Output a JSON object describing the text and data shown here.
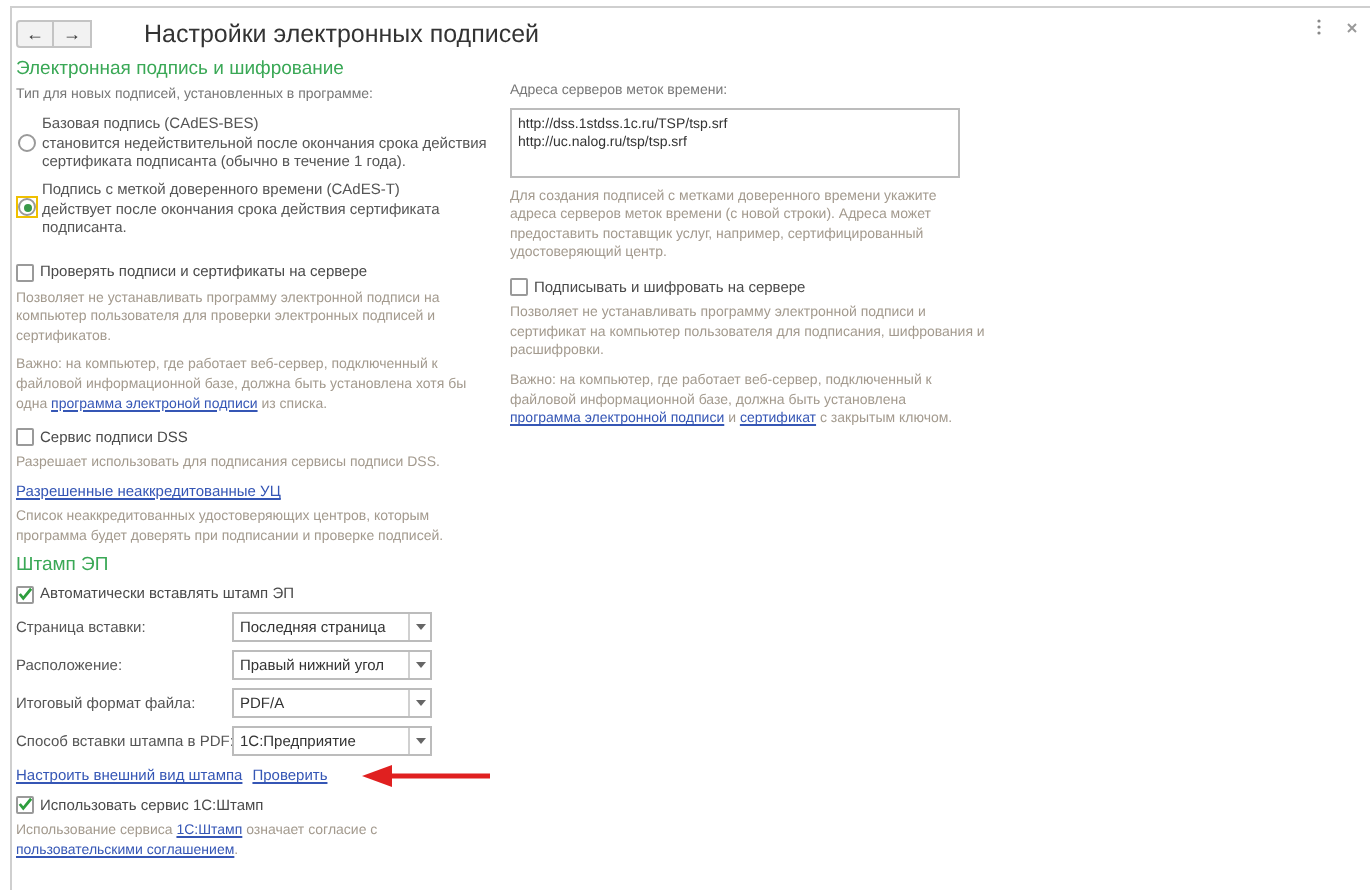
{
  "window": {
    "title": "Настройки электронных подписей",
    "nav": [
      "←",
      "→"
    ]
  },
  "left": {
    "section_title": "Электронная подпись и шифрование",
    "type_label": "Тип для новых подписей, установленных в программе:",
    "signature_types": [
      {
        "title": "Базовая подпись (CAdES-BES)",
        "description": "становится недействительной после окончания срока действия сертификата подписанта (обычно в течение 1 года).",
        "selected": false
      },
      {
        "title": "Подпись с меткой доверенного времени (CAdES-T)",
        "description": "действует после окончания срока действия сертификата подписанта.",
        "selected": true
      }
    ],
    "check_on_server": {
      "label": "Проверять подписи и сертификаты на сервере",
      "checked": false,
      "description": "Позволяет не устанавливать программу электронной подписи на компьютер пользователя для проверки электронных подписей и сертификатов.",
      "note": [
        {
          "text": "Важно: на компьютер, где работает веб-сервер, подключенный к файловой информационной базе, должна быть установлена хотя бы одна "
        },
        {
          "text": "программа электроной подписи",
          "link": true
        },
        {
          "text": " из списка."
        }
      ]
    },
    "dss": {
      "label": "Сервис подписи DSS",
      "checked": false,
      "description": "Разрешает использовать для подписания сервисы подписи DSS."
    },
    "untrusted_ca": {
      "link": "Разрешенные неаккредитованные УЦ",
      "description": "Список неаккредитованных удостоверяющих центров, которым программа будет доверять при подписании и проверке подписей."
    },
    "stamp": {
      "title": "Штамп ЭП",
      "auto_insert": {
        "label": "Автоматически вставлять штамп ЭП",
        "checked": true
      },
      "fields": [
        {
          "label": "Страница вставки:",
          "value": "Последняя страница"
        },
        {
          "label": "Расположение:",
          "value": "Правый нижний угол"
        },
        {
          "label": "Итоговый формат файла:",
          "value": "PDF/A"
        },
        {
          "label": "Способ вставки штампа в PDF:",
          "value": "1С:Предприятие"
        }
      ],
      "links": [
        "Настроить внешний вид штампа",
        "Проверить"
      ],
      "use_service": {
        "label": "Использовать сервис 1С:Штамп",
        "checked": true
      },
      "service_note": [
        {
          "text": "Использование сервиса "
        },
        {
          "text": "1С:Штамп",
          "link": true
        },
        {
          "text": " означает согласие с "
        },
        {
          "text": "пользовательскими соглашением",
          "link": true
        },
        {
          "text": "."
        }
      ]
    }
  },
  "right": {
    "timestamp_servers": {
      "label": "Адреса серверов меток времени:",
      "lines": [
        "http://dss.1stdss.1c.ru/TSP/tsp.srf",
        "http://uc.nalog.ru/tsp/tsp.srf"
      ],
      "description": "Для создания подписей с метками доверенного времени укажите адреса серверов меток времени (с новой строки). Адреса может предоставить поставщик услуг, например, сертифицированный удостоверяющий центр."
    },
    "sign_on_server": {
      "label": "Подписывать и шифровать на сервере",
      "checked": false,
      "description": "Позволяет не устанавливать программу электронной подписи и сертификат на компьютер пользователя для подписания, шифрования и расшифровки.",
      "note": [
        {
          "text": "Важно: на компьютер, где работает веб-сервер, подключенный к файловой информационной базе, должна быть установлена "
        },
        {
          "text": "программа электронной подписи",
          "link": true
        },
        {
          "text": " и "
        },
        {
          "text": "сертификат",
          "link": true
        },
        {
          "text": " с закрытым ключом."
        }
      ]
    }
  }
}
